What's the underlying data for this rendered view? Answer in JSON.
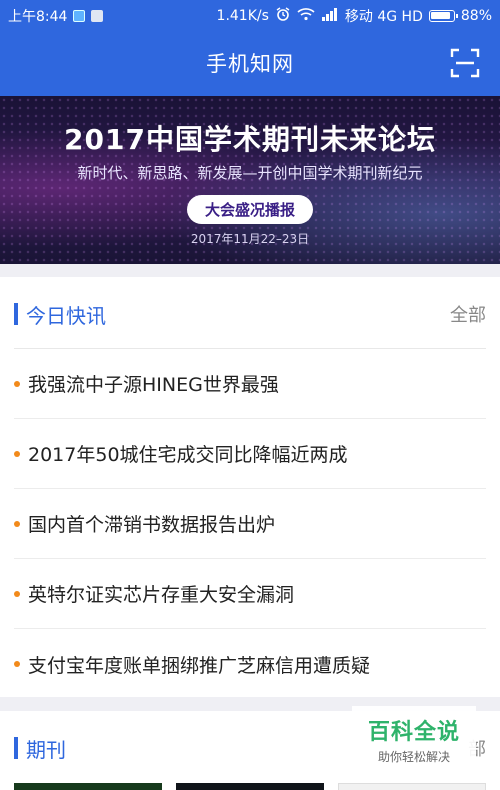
{
  "status_bar": {
    "time": "上午8:44",
    "speed": "1.41K/s",
    "carrier": "移动 4G HD",
    "battery": "88%"
  },
  "header": {
    "title": "手机知网",
    "scan_icon": "scan-icon"
  },
  "banner": {
    "title": "2017中国学术期刊未来论坛",
    "subtitle": "新时代、新思路、新发展—开创中国学术期刊新纪元",
    "button": "大会盛况播报",
    "date": "2017年11月22–23日"
  },
  "news": {
    "section_title": "今日快讯",
    "more_label": "全部",
    "items": [
      "我强流中子源HINEG世界最强",
      "2017年50城住宅成交同比降幅近两成",
      "国内首个滞销书数据报告出炉",
      "英特尔证实芯片存重大安全漏洞",
      "支付宝年度账单捆绑推广芝麻信用遭质疑"
    ]
  },
  "journals": {
    "section_title": "期刊",
    "more_label": "部"
  },
  "watermark": {
    "brand": "百科全说",
    "tagline": "助你轻松解决"
  },
  "colors": {
    "primary": "#2f67de",
    "bullet": "#f28a1b"
  }
}
